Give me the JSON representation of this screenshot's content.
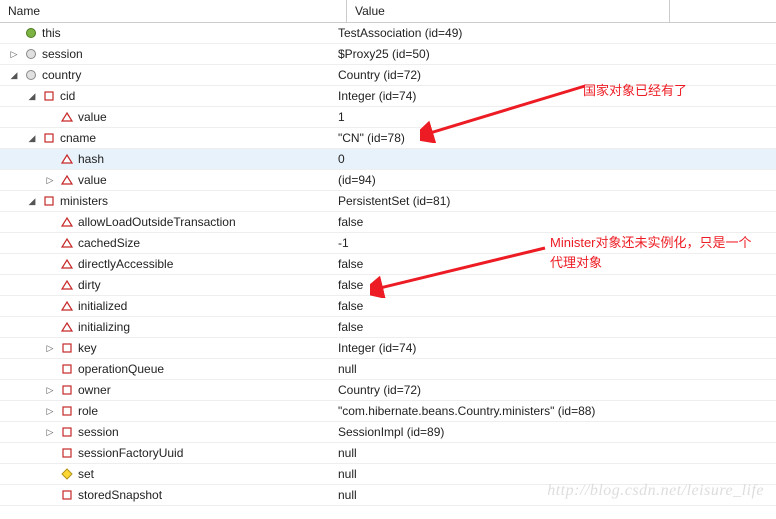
{
  "headers": {
    "name": "Name",
    "value": "Value"
  },
  "annotations": {
    "a1": "国家对象已经有了",
    "a2": "Minister对象还未实例化，只是一个代理对象"
  },
  "watermark": "http://blog.csdn.net/leisure_life",
  "rows": [
    {
      "indent": 0,
      "twist": "",
      "icon": "circle-green",
      "name": "this",
      "value": "TestAssociation  (id=49)"
    },
    {
      "indent": 0,
      "twist": "right",
      "icon": "circle-gray",
      "name": "session",
      "value": "$Proxy25  (id=50)"
    },
    {
      "indent": 0,
      "twist": "down",
      "icon": "circle-gray",
      "name": "country",
      "value": "Country  (id=72)"
    },
    {
      "indent": 1,
      "twist": "down",
      "icon": "square-red",
      "name": "cid",
      "value": "Integer  (id=74)"
    },
    {
      "indent": 2,
      "twist": "",
      "icon": "triangle-red",
      "name": "value",
      "value": "1"
    },
    {
      "indent": 1,
      "twist": "down",
      "icon": "square-red",
      "name": "cname",
      "value": "\"CN\" (id=78)"
    },
    {
      "indent": 2,
      "twist": "",
      "icon": "triangle-red",
      "name": "hash",
      "value": "0",
      "hl": true
    },
    {
      "indent": 2,
      "twist": "right",
      "icon": "triangle-red",
      "name": "value",
      "value": "(id=94)"
    },
    {
      "indent": 1,
      "twist": "down",
      "icon": "square-red",
      "name": "ministers",
      "value": "PersistentSet  (id=81)"
    },
    {
      "indent": 2,
      "twist": "",
      "icon": "triangle-red",
      "name": "allowLoadOutsideTransaction",
      "value": "false"
    },
    {
      "indent": 2,
      "twist": "",
      "icon": "triangle-red",
      "name": "cachedSize",
      "value": "-1"
    },
    {
      "indent": 2,
      "twist": "",
      "icon": "triangle-red",
      "name": "directlyAccessible",
      "value": "false"
    },
    {
      "indent": 2,
      "twist": "",
      "icon": "triangle-red",
      "name": "dirty",
      "value": "false"
    },
    {
      "indent": 2,
      "twist": "",
      "icon": "triangle-red",
      "name": "initialized",
      "value": "false"
    },
    {
      "indent": 2,
      "twist": "",
      "icon": "triangle-red",
      "name": "initializing",
      "value": "false"
    },
    {
      "indent": 2,
      "twist": "right",
      "icon": "square-red",
      "name": "key",
      "value": "Integer  (id=74)"
    },
    {
      "indent": 2,
      "twist": "",
      "icon": "square-red",
      "name": "operationQueue",
      "value": "null"
    },
    {
      "indent": 2,
      "twist": "right",
      "icon": "square-red",
      "name": "owner",
      "value": "Country  (id=72)"
    },
    {
      "indent": 2,
      "twist": "right",
      "icon": "square-red",
      "name": "role",
      "value": "\"com.hibernate.beans.Country.ministers\" (id=88)"
    },
    {
      "indent": 2,
      "twist": "right",
      "icon": "square-red",
      "name": "session",
      "value": "SessionImpl  (id=89)"
    },
    {
      "indent": 2,
      "twist": "",
      "icon": "square-red",
      "name": "sessionFactoryUuid",
      "value": "null"
    },
    {
      "indent": 2,
      "twist": "",
      "icon": "diamond-yellow",
      "name": "set",
      "value": "null"
    },
    {
      "indent": 2,
      "twist": "",
      "icon": "square-red",
      "name": "storedSnapshot",
      "value": "null"
    }
  ]
}
